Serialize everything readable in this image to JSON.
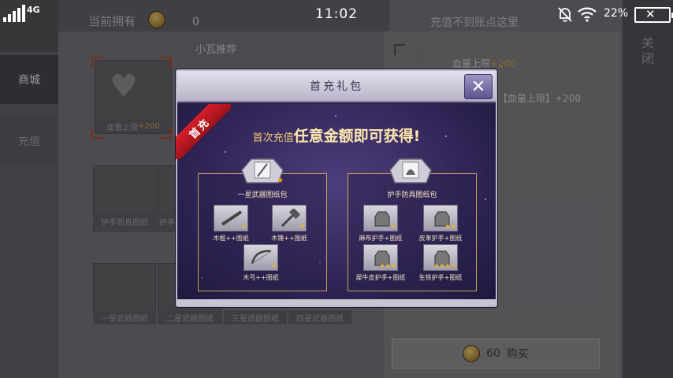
{
  "status_bar": {
    "network": "4G",
    "time": "11:02",
    "battery": "22%"
  },
  "shop": {
    "owned_label": "当前拥有",
    "owned_value": "0",
    "section_title": "小瓦推荐",
    "right_hint": "充值不到账点这里",
    "close_label": "关闭",
    "sidebar": [
      {
        "label": "商城"
      },
      {
        "label": "充值"
      }
    ],
    "selected_item": {
      "label": "血量上限",
      "bonus": "+200"
    },
    "row2_labels": [
      "护手防具图纸",
      "护手"
    ],
    "row3_labels": [
      "一星武器图纸",
      "二星武器图纸",
      "三星武器图纸",
      "四星武器图纸"
    ],
    "detail_label": "血量上限",
    "detail_bonus": "+200",
    "detail_desc": "【血量上限】+200",
    "buy_price": "60",
    "buy_label": "购买"
  },
  "modal": {
    "title": "首充礼包",
    "ribbon": "首充",
    "headline_pre": "首次充值",
    "headline_big": "任意金额即可",
    "headline_post": "获得!",
    "left_pack": {
      "name": "一星武器图纸包",
      "items": [
        {
          "name": "木棍++图纸",
          "stars": 1
        },
        {
          "name": "木锤++图纸",
          "stars": 1
        },
        {
          "name": "木弓++图纸",
          "stars": 1
        }
      ]
    },
    "right_pack": {
      "name": "护手防具图纸包",
      "items": [
        {
          "name": "麻布护手+图纸",
          "stars": 1
        },
        {
          "name": "皮革护手+图纸",
          "stars": 2
        },
        {
          "name": "犀牛皮护手+图纸",
          "stars": 3
        },
        {
          "name": "生铁护手+图纸",
          "stars": 4
        }
      ]
    }
  },
  "colors": {
    "accent": "#c9a55a",
    "ribbon": "#d51f2a",
    "star": "#f2b21c"
  }
}
